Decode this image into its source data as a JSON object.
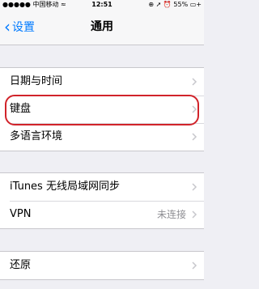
{
  "status_bar": {
    "carrier": "●●●●● 中国移动 ≈",
    "time": "12:51",
    "right": "⊕ ➚ ⏰ 55% ▭+"
  },
  "nav": {
    "back_label": "设置",
    "title": "通用"
  },
  "groups": [
    {
      "rows": [
        {
          "label": "日期与时间",
          "value": ""
        },
        {
          "label": "键盘",
          "value": ""
        },
        {
          "label": "多语言环境",
          "value": ""
        }
      ]
    },
    {
      "rows": [
        {
          "label": "iTunes 无线局域网同步",
          "value": ""
        },
        {
          "label": "VPN",
          "value": "未连接"
        }
      ]
    },
    {
      "rows": [
        {
          "label": "还原",
          "value": ""
        }
      ]
    }
  ],
  "highlighted_row": "键盘",
  "colors": {
    "accent": "#007aff",
    "background": "#efeff4",
    "highlight": "#d1232a"
  },
  "icons": {
    "back": "chevron-left-icon",
    "disclosure": "chevron-right-icon"
  }
}
